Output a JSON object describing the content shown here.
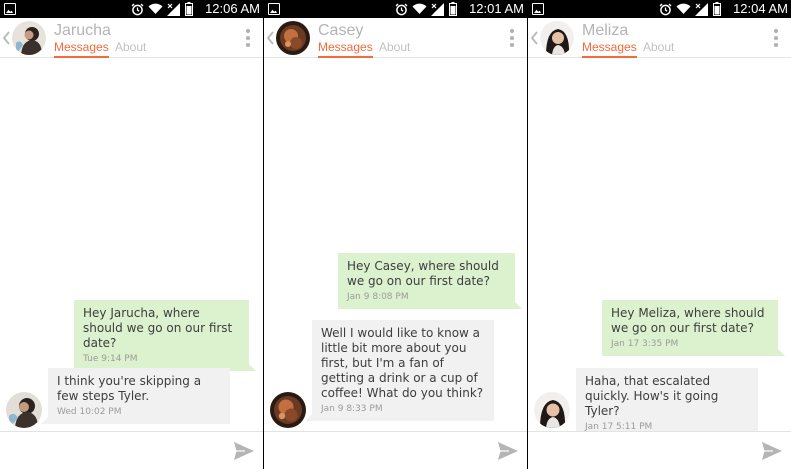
{
  "icons": {
    "gallery": "gallery-icon",
    "alarm": "alarm-icon",
    "wifi": "wifi-icon",
    "signal": "signal-icon",
    "battery": "battery-icon",
    "back": "back-chevron-icon",
    "menu": "overflow-menu-icon",
    "send": "send-icon"
  },
  "colors": {
    "accent": "#f26b3a",
    "outgoing_bubble": "#dcf2cf",
    "incoming_bubble": "#f1f1f1",
    "title_text": "#b4b4b4"
  },
  "panels": [
    {
      "status_time": "12:06 AM",
      "contact_name": "Jarucha",
      "tabs": {
        "active": "Messages",
        "inactive": "About"
      },
      "messages": [
        {
          "direction": "out",
          "text": "Hey Jarucha, where should we go on our first date?",
          "time": "Tue 9:14 PM"
        },
        {
          "direction": "in",
          "text": "I think you're skipping a few steps Tyler.",
          "time": "Wed  10:02 PM"
        }
      ]
    },
    {
      "status_time": "12:01 AM",
      "contact_name": "Casey",
      "tabs": {
        "active": "Messages",
        "inactive": "About"
      },
      "messages": [
        {
          "direction": "out",
          "text": "Hey Casey, where should we go on our first date?",
          "time": "Jan 9  8:08 PM"
        },
        {
          "direction": "in",
          "text": "Well I would like to know a little bit more about you first, but I'm a fan of getting a drink or a cup of coffee! What do you think?",
          "time": "Jan 9  8:33 PM"
        }
      ]
    },
    {
      "status_time": "12:04 AM",
      "contact_name": "Meliza",
      "tabs": {
        "active": "Messages",
        "inactive": "About"
      },
      "messages": [
        {
          "direction": "out",
          "text": "Hey Meliza, where should we go on our first date?",
          "time": "Jan 17  3:35 PM"
        },
        {
          "direction": "in",
          "text": "Haha, that escalated quickly. How's it going Tyler?",
          "time": "Jan 17  5:11 PM"
        }
      ]
    }
  ]
}
